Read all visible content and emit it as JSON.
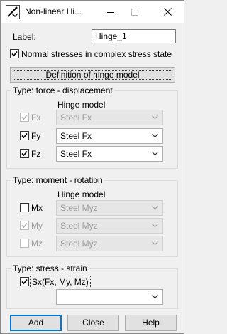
{
  "window": {
    "title": "Non-linear Hi..."
  },
  "label_field": {
    "label": "Label:",
    "value": "Hinge_1"
  },
  "normal_stresses": {
    "label": "Normal stresses in complex stress state",
    "checked": true
  },
  "definition_button": {
    "label": "Definition of hinge model"
  },
  "force_group": {
    "title": "Type: force - displacement",
    "hinge_model_header": "Hinge model",
    "rows": [
      {
        "label": "Fx",
        "checked": true,
        "enabled": false,
        "model": "Steel Fx"
      },
      {
        "label": "Fy",
        "checked": true,
        "enabled": true,
        "model": "Steel Fx"
      },
      {
        "label": "Fz",
        "checked": true,
        "enabled": true,
        "model": "Steel Fx"
      }
    ]
  },
  "moment_group": {
    "title": "Type: moment - rotation",
    "hinge_model_header": "Hinge model",
    "rows": [
      {
        "label": "Mx",
        "checked": false,
        "enabled": true,
        "model": "Steel Myz"
      },
      {
        "label": "My",
        "checked": true,
        "enabled": false,
        "model": "Steel Myz"
      },
      {
        "label": "Mz",
        "checked": false,
        "enabled": false,
        "model": "Steel Myz"
      }
    ]
  },
  "stress_group": {
    "title": "Type: stress - strain",
    "row": {
      "label": "Sx(Fx, My, Mz)",
      "checked": true,
      "model": ""
    }
  },
  "buttons": {
    "add": "Add",
    "close": "Close",
    "help": "Help"
  },
  "colors": {
    "accent": "#0078d7",
    "disabled_text": "#9a9a9a"
  }
}
